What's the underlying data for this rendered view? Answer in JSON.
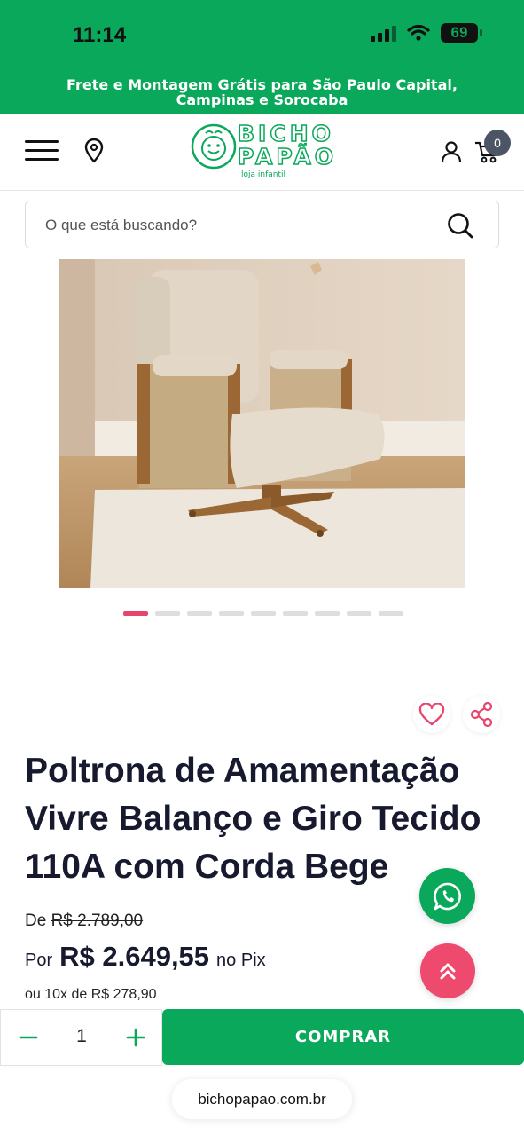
{
  "status_bar": {
    "time": "11:14",
    "battery": "69"
  },
  "promo_banner": {
    "text": "Frete e Montagem Grátis para São Paulo Capital, Campinas e Sorocaba"
  },
  "header": {
    "logo_line1": "BICHO",
    "logo_line2": "PAPÃO",
    "logo_subtitle": "loja infantil",
    "cart_count": "0",
    "icons": [
      "menu-icon",
      "location-pin-icon",
      "user-icon",
      "cart-icon"
    ]
  },
  "search": {
    "placeholder": "O que está buscando?"
  },
  "gallery": {
    "total_images": 9,
    "active_index": 0
  },
  "product": {
    "title": "Poltrona de Amamentação Vivre Balanço e Giro Tecido 110A com Corda Bege",
    "price_old_prefix": "De",
    "price_old": "R$ 2.789,00",
    "price_prefix": "Por",
    "price": "R$ 2.649,55",
    "price_suffix": "no Pix",
    "installments": "ou 10x de R$ 278,90"
  },
  "buy_bar": {
    "quantity": "1",
    "buy_label": "COMPRAR"
  },
  "browser": {
    "url": "bichopapao.com.br"
  },
  "colors": {
    "brand_green": "#0aa85a",
    "accent_pink": "#e8456c",
    "title_dark": "#171a2f"
  }
}
